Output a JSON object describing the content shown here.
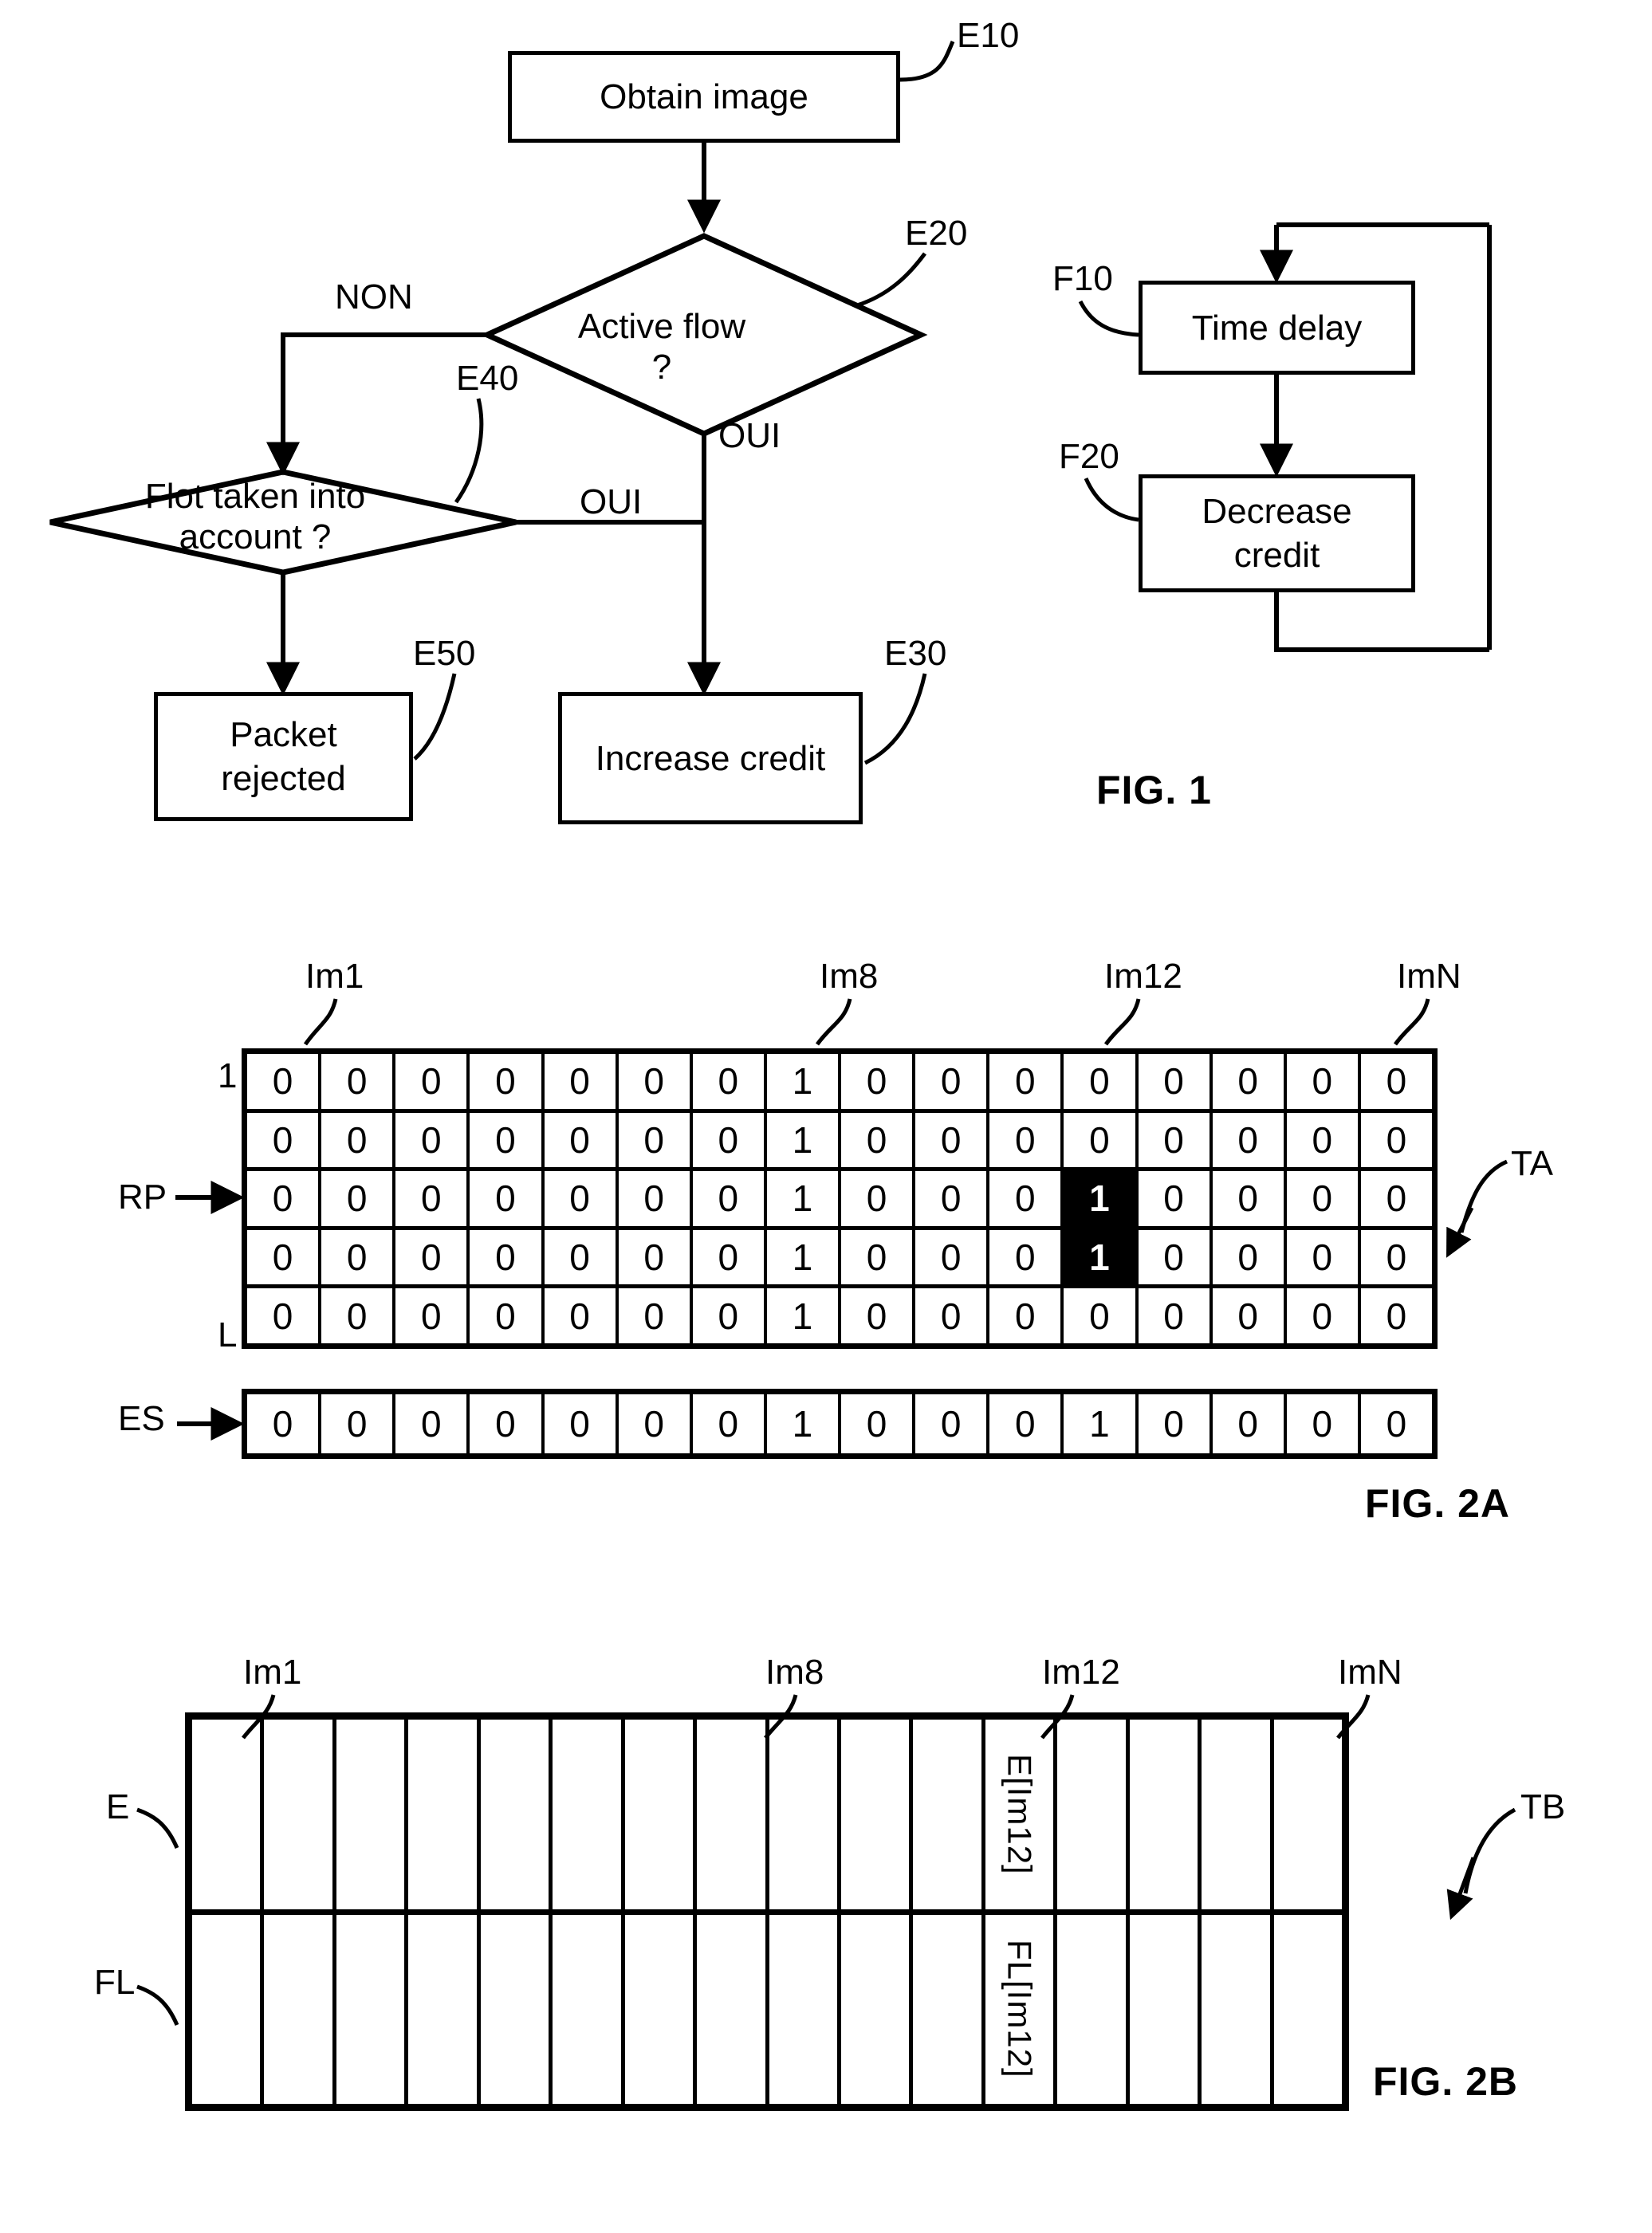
{
  "figures": [
    {
      "id": "fig1",
      "label": "FIG. 1"
    },
    {
      "id": "fig2a",
      "label": "FIG. 2A"
    },
    {
      "id": "fig2b",
      "label": "FIG. 2B"
    }
  ],
  "fig1": {
    "caption": "FIG. 1",
    "left_flow": {
      "nodes": [
        {
          "key": "obtain_image",
          "text": "Obtain image",
          "ref": "E10",
          "shape": "process"
        },
        {
          "key": "active_flow",
          "text": "Active flow\n?",
          "ref": "E20",
          "shape": "decision"
        },
        {
          "key": "flot_account",
          "text": "Flot taken into\naccount ?",
          "ref": "E40",
          "shape": "decision"
        },
        {
          "key": "packet_rejected",
          "text": "Packet\nrejected",
          "ref": "E50",
          "shape": "process"
        },
        {
          "key": "increase_credit",
          "text": "Increase credit",
          "ref": "E30",
          "shape": "process"
        }
      ],
      "branch_labels": {
        "active_flow_no": "NON",
        "active_flow_yes": "OUI",
        "flot_yes": "OUI"
      }
    },
    "right_flow": {
      "nodes": [
        {
          "key": "time_delay",
          "text": "Time delay",
          "ref": "F10",
          "shape": "process"
        },
        {
          "key": "decrease_credit",
          "text": "Decrease\ncredit",
          "ref": "F20",
          "shape": "process"
        }
      ]
    }
  },
  "fig2a": {
    "caption": "FIG. 2A",
    "table_ref": "TA",
    "column_labels": [
      {
        "text": "Im1",
        "col": 1
      },
      {
        "text": "Im8",
        "col": 8
      },
      {
        "text": "Im12",
        "col": 12
      },
      {
        "text": "ImN",
        "col": 16
      }
    ],
    "row_labels": {
      "first": "1",
      "last": "L",
      "pointer": "RP",
      "pointer_row": 3
    },
    "columns": 16,
    "rows": [
      {
        "cells": [
          "0",
          "0",
          "0",
          "0",
          "0",
          "0",
          "0",
          "1",
          "0",
          "0",
          "0",
          "0",
          "0",
          "0",
          "0",
          "0"
        ],
        "highlight": []
      },
      {
        "cells": [
          "0",
          "0",
          "0",
          "0",
          "0",
          "0",
          "0",
          "1",
          "0",
          "0",
          "0",
          "0",
          "0",
          "0",
          "0",
          "0"
        ],
        "highlight": []
      },
      {
        "cells": [
          "0",
          "0",
          "0",
          "0",
          "0",
          "0",
          "0",
          "1",
          "0",
          "0",
          "0",
          "1",
          "0",
          "0",
          "0",
          "0"
        ],
        "highlight": [
          12
        ]
      },
      {
        "cells": [
          "0",
          "0",
          "0",
          "0",
          "0",
          "0",
          "0",
          "1",
          "0",
          "0",
          "0",
          "1",
          "0",
          "0",
          "0",
          "0"
        ],
        "highlight": [
          12
        ]
      },
      {
        "cells": [
          "0",
          "0",
          "0",
          "0",
          "0",
          "0",
          "0",
          "1",
          "0",
          "0",
          "0",
          "0",
          "0",
          "0",
          "0",
          "0"
        ],
        "highlight": []
      }
    ],
    "es": {
      "label": "ES",
      "cells": [
        "0",
        "0",
        "0",
        "0",
        "0",
        "0",
        "0",
        "1",
        "0",
        "0",
        "0",
        "1",
        "0",
        "0",
        "0",
        "0"
      ]
    }
  },
  "fig2b": {
    "caption": "FIG. 2B",
    "table_ref": "TB",
    "column_labels": [
      {
        "text": "Im1",
        "col": 1
      },
      {
        "text": "Im8",
        "col": 8
      },
      {
        "text": "Im12",
        "col": 12
      },
      {
        "text": "ImN",
        "col": 16
      }
    ],
    "row_labels": [
      {
        "text": "E"
      },
      {
        "text": "FL"
      }
    ],
    "columns": 16,
    "rows": [
      {
        "label": "E",
        "cells": [
          "",
          "",
          "",
          "",
          "",
          "",
          "",
          "",
          "",
          "",
          "",
          "E[Im12]",
          "",
          "",
          "",
          ""
        ]
      },
      {
        "label": "FL",
        "cells": [
          "",
          "",
          "",
          "",
          "",
          "",
          "",
          "",
          "",
          "",
          "",
          "FL[Im12]",
          "",
          "",
          "",
          ""
        ]
      }
    ]
  }
}
